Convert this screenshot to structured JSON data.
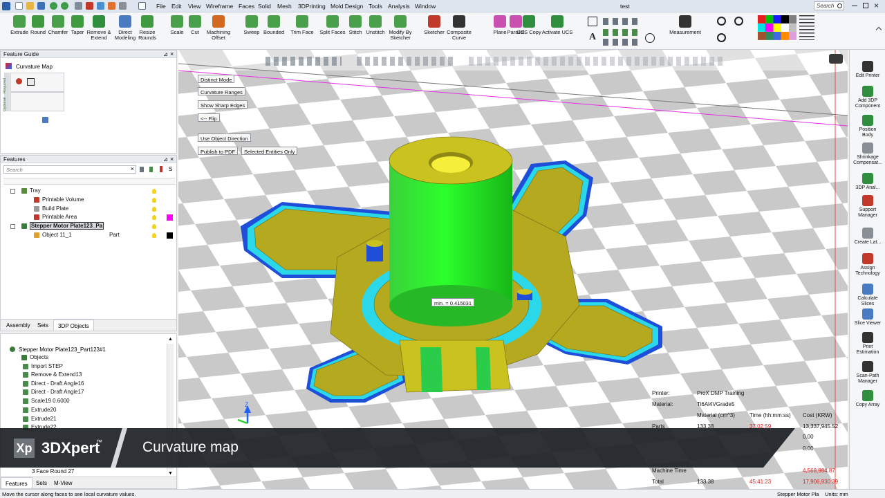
{
  "window": {
    "title": "test",
    "search_placeholder": "Search"
  },
  "menu": [
    "File",
    "Edit",
    "View",
    "Wireframe",
    "Faces",
    "Solid",
    "Mesh",
    "3DPrinting",
    "Mold Design",
    "Tools",
    "Analysis",
    "Window"
  ],
  "ribbon": [
    {
      "label": "Extrude",
      "color": "#4aa04a"
    },
    {
      "label": "Round",
      "color": "#3f9a3f"
    },
    {
      "label": "Chamfer",
      "color": "#4aa04a"
    },
    {
      "label": "Taper",
      "color": "#3f9a3f"
    },
    {
      "label": "Remove &\nExtend",
      "color": "#2f8f3f"
    },
    {
      "label": "Direct\nModeling",
      "color": "#4a7ac0"
    },
    {
      "label": "Resize\nRounds",
      "color": "#3f9a3f"
    },
    {
      "label": "Scale",
      "color": "#4aa04a"
    },
    {
      "label": "Cut",
      "color": "#4aa04a"
    },
    {
      "label": "Machining\nOffset",
      "color": "#d2691e"
    },
    {
      "label": "Sweep",
      "color": "#4aa04a"
    },
    {
      "label": "Bounded",
      "color": "#4aa04a"
    },
    {
      "label": "Trim Face",
      "color": "#4aa04a"
    },
    {
      "label": "Split Faces",
      "color": "#4aa04a"
    },
    {
      "label": "Stitch",
      "color": "#4aa04a"
    },
    {
      "label": "Unstitch",
      "color": "#4aa04a"
    },
    {
      "label": "Modify By\nSketcher",
      "color": "#4aa04a"
    },
    {
      "label": "Sketcher",
      "color": "#c0392b"
    },
    {
      "label": "Composite\nCurve",
      "color": "#333333"
    },
    {
      "label": "Plane",
      "color": "#c94fb0"
    },
    {
      "label": "Parallel",
      "color": "#c94fb0"
    },
    {
      "label": "UCS Copy",
      "color": "#2f8f3f"
    },
    {
      "label": "Activate UCS",
      "color": "#2f8f3f"
    },
    {
      "label": "Measurement",
      "color": "#333333"
    }
  ],
  "feature_guide": {
    "title": "Feature Guide",
    "item": "Curvature Map",
    "side_tabs": [
      "Required",
      "Optional"
    ]
  },
  "features": {
    "title": "Features",
    "search_placeholder": "Search",
    "tree": [
      {
        "label": "Tray",
        "level": 1,
        "icon": "#5a8a3a"
      },
      {
        "label": "Printable Volume",
        "level": 2,
        "icon": "#c0392b"
      },
      {
        "label": "Build Plate",
        "level": 2,
        "icon": "#999999"
      },
      {
        "label": "Printable Area",
        "level": 2,
        "icon": "#c0392b",
        "swatch": "#ff00ff"
      },
      {
        "label": "Stepper Motor Plate123_Pa",
        "level": 1,
        "icon": "#3a7a3a",
        "selected": true
      },
      {
        "label": "Object 11_1",
        "level": 2,
        "icon": "#e0a030",
        "tag": "Part",
        "swatch": "#000000"
      }
    ],
    "tabs": [
      "Assembly",
      "Sets",
      "3DP Objects"
    ]
  },
  "history": {
    "title": "Stepper Motor Plate123_Part123#1",
    "items": [
      "Objects",
      "Import STEP",
      "Remove & Extend13",
      "Direct - Draft Angle16",
      "Direct - Draft Angle17",
      "Scale19 0.6000",
      "Extrude20",
      "Extrude21",
      "Extrude22"
    ],
    "last_item": "3 Face Round 27",
    "tabs": [
      "Features",
      "Sets",
      "M-View"
    ]
  },
  "viewport": {
    "buttons": [
      "Distinct Mode",
      "Curvature Ranges",
      "Show Sharp Edges",
      "<-- Flip",
      "Use Object Direction",
      "Publish to PDF",
      "Selected Entities Only"
    ],
    "tooltip": "min. = 0.415031",
    "axis_label": "Z"
  },
  "info": {
    "printer_label": "Printer:",
    "printer": "ProX DMP Training",
    "material_label": "Material:",
    "material": "Ti6Al4VGrade5",
    "headers": [
      "Material (cm^3)",
      "Time (hh:mm:ss)",
      "Cost (KRW)"
    ],
    "parts_label": "Parts",
    "parts_material": "133.38",
    "parts_time": "37:02:59",
    "parts_cost": "13,337,945.52",
    "cost_a": "0.00",
    "cost_b": "0.00",
    "machine_label": "Machine Time",
    "machine_cost": "4,568,984.87",
    "total_label": "Total",
    "total_material": "133.38",
    "total_time": "45:41:23",
    "total_cost": "17,906,930.39"
  },
  "right_toolbar": [
    "Edit Printer",
    "Add 3DP\nComponent",
    "Position\nBody",
    "Shrinkage\nCompensat...",
    "3DP Anal...",
    "Support\nManager",
    "Create Lat...",
    "Assign\nTechnology",
    "Calculate\nSlices",
    "Slice Viewer",
    "Print\nEstimation",
    "Scan-Path\nManager",
    "Copy Array"
  ],
  "banner": {
    "logo_mark": "Xp",
    "brand": "3DXpert",
    "trademark": "™",
    "caption": "Curvature map"
  },
  "status": {
    "message": "Move the cursor along faces to see local curvature values.",
    "object": "Stepper Motor Pla",
    "units": "Units: mm"
  }
}
